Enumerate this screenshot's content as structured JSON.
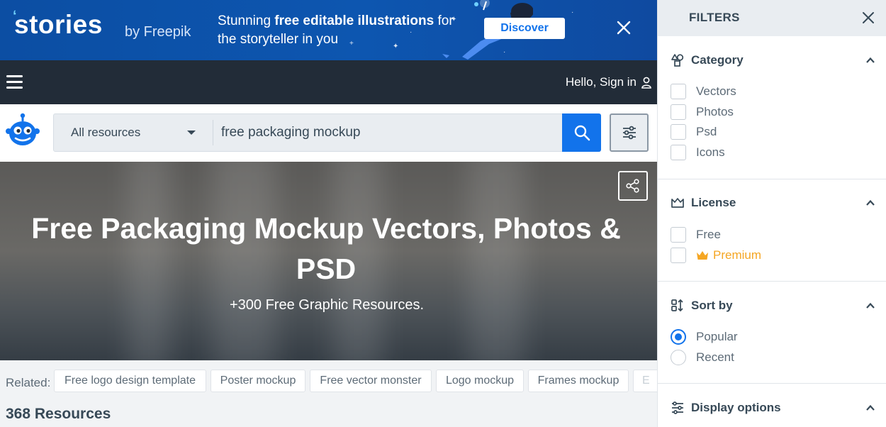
{
  "promo": {
    "brand": "stories",
    "by_line": "by Freepik",
    "text_plain_1": "Stunning ",
    "text_bold": "free editable illustrations",
    "text_plain_2": " for the storyteller in you",
    "cta_label": "Discover"
  },
  "topbar": {
    "signin_label": "Hello, Sign in"
  },
  "search": {
    "resource_type": "All resources",
    "query": "free packaging mockup"
  },
  "hero": {
    "title": "Free Packaging Mockup Vectors, Photos & PSD",
    "subtitle": "+300 Free Graphic Resources."
  },
  "related": {
    "label": "Related:",
    "tags": [
      "Free logo design template",
      "Poster mockup",
      "Free vector monster",
      "Logo mockup",
      "Frames mockup",
      "E"
    ]
  },
  "results": {
    "count_label": "368 Resources"
  },
  "filters": {
    "title": "FILTERS",
    "sections": [
      {
        "title": "Category",
        "icon": "shapes-icon",
        "options": [
          "Vectors",
          "Photos",
          "Psd",
          "Icons"
        ]
      },
      {
        "title": "License",
        "icon": "crown-outline-icon",
        "options": [
          "Free",
          "Premium"
        ]
      },
      {
        "title": "Sort by",
        "icon": "sort-icon",
        "options": [
          "Popular",
          "Recent"
        ],
        "selected": "Popular"
      },
      {
        "title": "Display options",
        "icon": "sliders-icon"
      }
    ]
  },
  "colors": {
    "accent": "#1273eb",
    "topbar": "#222c38",
    "promo": "#0d56b0",
    "premium": "#f5a623"
  }
}
